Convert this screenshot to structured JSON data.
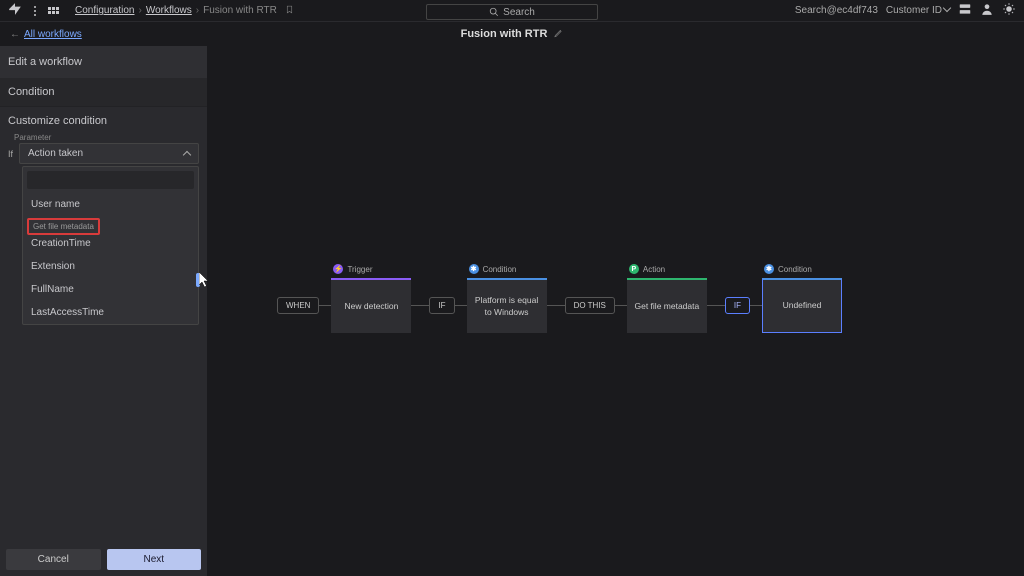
{
  "topbar": {
    "breadcrumb": {
      "configuration": "Configuration",
      "workflows": "Workflows",
      "current": "Fusion with RTR"
    },
    "search_placeholder": "Search",
    "account": "Search@ec4df743",
    "customer_id": "Customer ID"
  },
  "subheader": {
    "back": "All workflows",
    "title": "Fusion with RTR"
  },
  "sidebar": {
    "edit_title": "Edit a workflow",
    "condition_title": "Condition",
    "customize_title": "Customize condition",
    "param_label": "Parameter",
    "if_label": "If",
    "selected_param": "Action taken",
    "dropdown": {
      "header": "Get file metadata",
      "items": [
        "User name",
        "CreationTime",
        "Extension",
        "FullName",
        "LastAccessTime"
      ]
    },
    "cancel": "Cancel",
    "next": "Next"
  },
  "flow": {
    "when": "WHEN",
    "if": "IF",
    "dothis": "DO THIS",
    "labels": {
      "trigger": "Trigger",
      "condition": "Condition",
      "action": "Action"
    },
    "nodes": {
      "trigger": "New detection",
      "cond1": "Platform is equal to Windows",
      "action": "Get file metadata",
      "cond2": "Undefined"
    }
  }
}
